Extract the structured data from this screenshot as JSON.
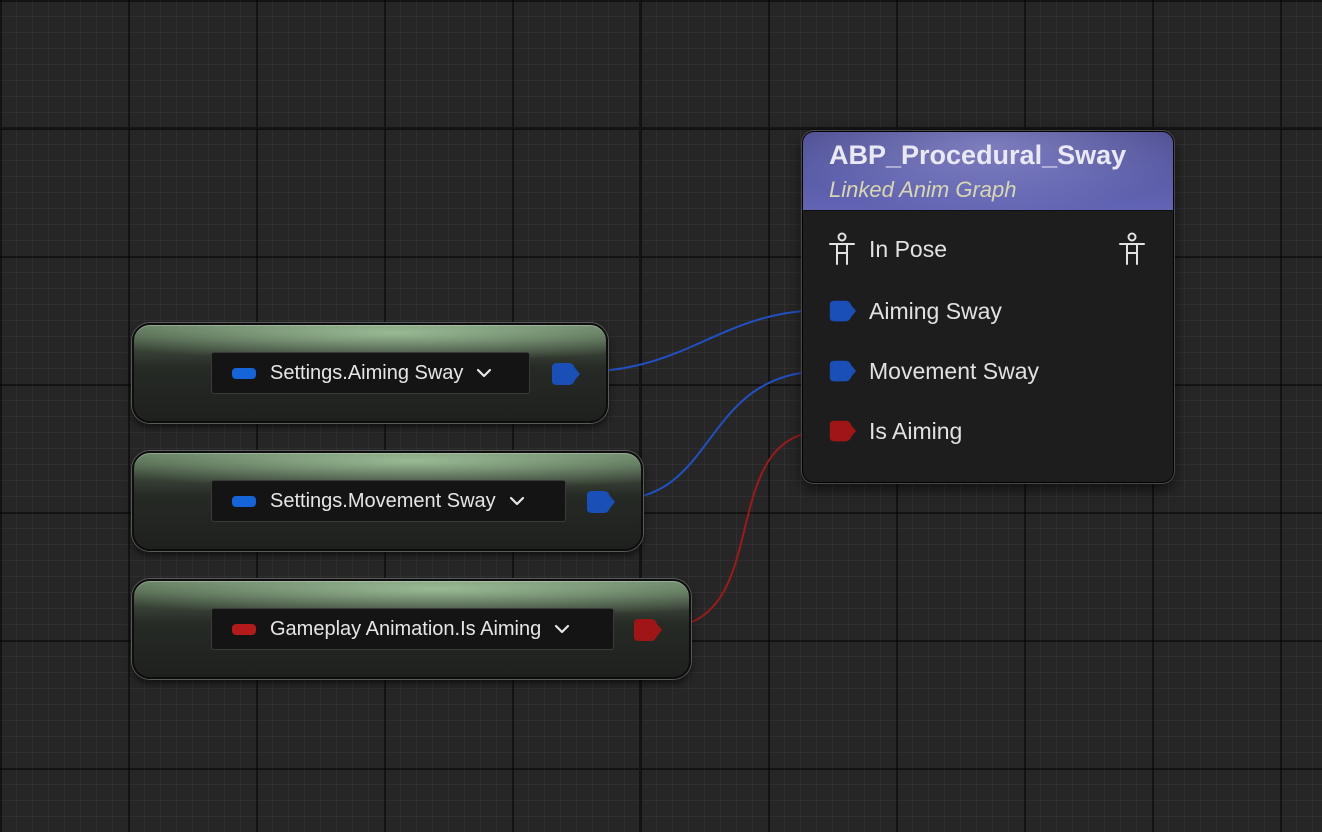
{
  "graph": {
    "colors": {
      "float_pin": "#1a4fb8",
      "float_pill": "#1564d8",
      "bool_pin": "#a01616",
      "bool_pill": "#b31b1b",
      "float_wire": "#2150c4",
      "bool_wire": "#9c1a1a",
      "header_accent": "#5a5ca8",
      "node_body": "#1c1d1c"
    },
    "variable_nodes": [
      {
        "label": "Settings.Aiming Sway",
        "pin_type": "float",
        "icon": "chevron-down-icon"
      },
      {
        "label": "Settings.Movement Sway",
        "pin_type": "float",
        "icon": "chevron-down-icon"
      },
      {
        "label": "Gameplay Animation.Is Aiming",
        "pin_type": "bool",
        "icon": "chevron-down-icon"
      }
    ],
    "anim_node": {
      "title": "ABP_Procedural_Sway",
      "subtitle": "Linked Anim Graph",
      "pose_pin": {
        "label": "In Pose",
        "icon": "pose-icon"
      },
      "input_pins": [
        {
          "label": "Aiming Sway",
          "pin_type": "float"
        },
        {
          "label": "Movement Sway",
          "pin_type": "float"
        },
        {
          "label": "Is Aiming",
          "pin_type": "bool"
        }
      ]
    }
  }
}
